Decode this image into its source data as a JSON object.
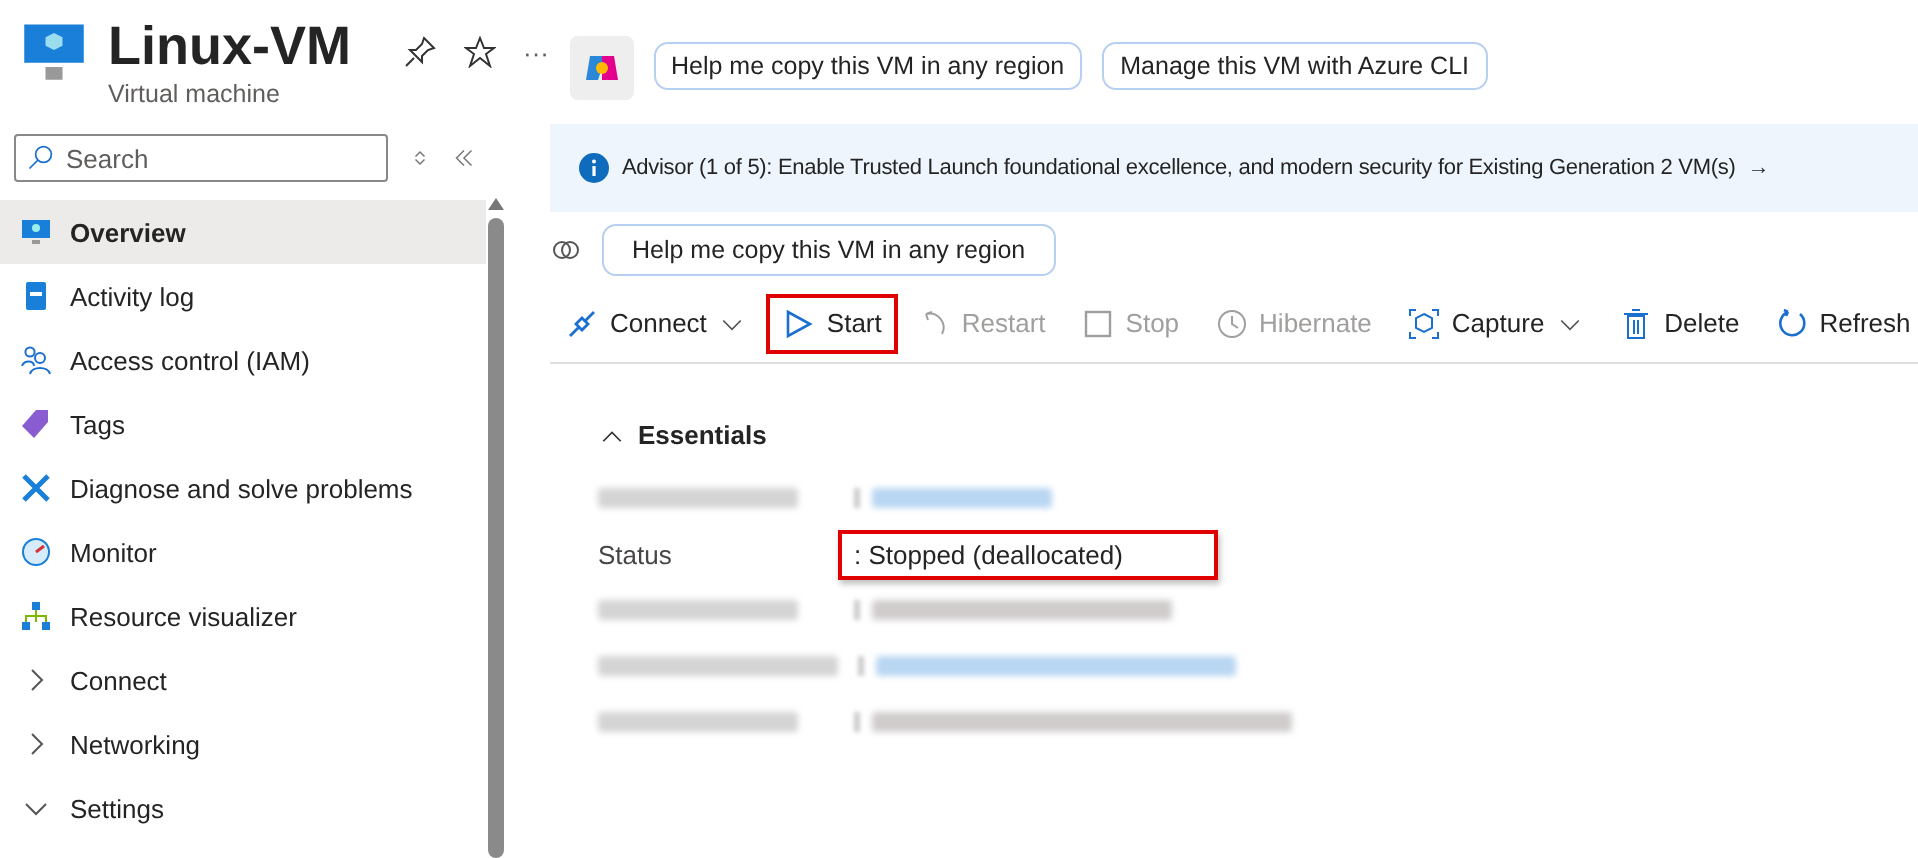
{
  "header": {
    "title": "Linux-VM",
    "subtitle": "Virtual machine",
    "more": "···",
    "actions": [
      "Help me copy this VM in any region",
      "Manage this VM with Azure CLI"
    ]
  },
  "sidebar": {
    "search": {
      "placeholder": "Search"
    },
    "items": [
      {
        "kind": "overview",
        "label": "Overview",
        "selected": true
      },
      {
        "kind": "log",
        "label": "Activity log",
        "selected": false
      },
      {
        "kind": "iam",
        "label": "Access control (IAM)",
        "selected": false
      },
      {
        "kind": "tags",
        "label": "Tags",
        "selected": false
      },
      {
        "kind": "diagnose",
        "label": "Diagnose and solve problems",
        "selected": false
      },
      {
        "kind": "monitor",
        "label": "Monitor",
        "selected": false
      },
      {
        "kind": "visualizer",
        "label": "Resource visualizer",
        "selected": false
      },
      {
        "kind": "group",
        "label": "Connect",
        "selected": false,
        "expanded": false
      },
      {
        "kind": "group",
        "label": "Networking",
        "selected": false,
        "expanded": false
      },
      {
        "kind": "group",
        "label": "Settings",
        "selected": false,
        "expanded": true
      }
    ]
  },
  "advisor": {
    "text": "Advisor (1 of 5): Enable Trusted Launch foundational excellence, and modern security for Existing Generation 2 VM(s)",
    "arrow": "→"
  },
  "copilot_prompt": "Help me copy this VM in any region",
  "toolbar": [
    {
      "kind": "connect",
      "label": "Connect",
      "disabled": false,
      "highlighted": false,
      "dropdown": true
    },
    {
      "kind": "start",
      "label": "Start",
      "disabled": false,
      "highlighted": true,
      "dropdown": false
    },
    {
      "kind": "restart",
      "label": "Restart",
      "disabled": true,
      "highlighted": false,
      "dropdown": false
    },
    {
      "kind": "stop",
      "label": "Stop",
      "disabled": true,
      "highlighted": false,
      "dropdown": false
    },
    {
      "kind": "hibernate",
      "label": "Hibernate",
      "disabled": true,
      "highlighted": false,
      "dropdown": false
    },
    {
      "kind": "capture",
      "label": "Capture",
      "disabled": false,
      "highlighted": false,
      "dropdown": true
    },
    {
      "kind": "delete",
      "label": "Delete",
      "disabled": false,
      "highlighted": false,
      "dropdown": false
    },
    {
      "kind": "refresh",
      "label": "Refresh",
      "disabled": false,
      "highlighted": false,
      "dropdown": false
    }
  ],
  "essentials": {
    "title": "Essentials",
    "expanded": true,
    "rows": [
      {
        "kind": "redacted",
        "value_link": true
      },
      {
        "kind": "field",
        "label": "Status",
        "value": ": Stopped (deallocated)",
        "highlighted": true
      },
      {
        "kind": "redacted",
        "value_link": false
      },
      {
        "kind": "redacted",
        "value_link": true
      },
      {
        "kind": "redacted",
        "value_link": false
      }
    ]
  }
}
